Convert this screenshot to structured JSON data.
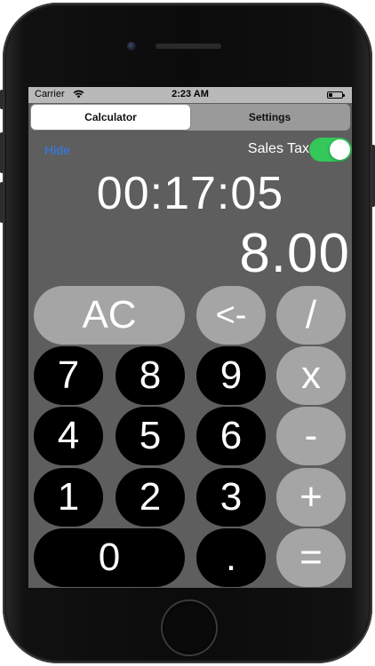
{
  "status_bar": {
    "carrier": "Carrier",
    "time": "2:23 AM"
  },
  "segments": [
    {
      "label": "Calculator",
      "active": true
    },
    {
      "label": "Settings",
      "active": false
    }
  ],
  "controls": {
    "hide_label": "Hide",
    "sales_tax_label": "Sales Tax",
    "sales_tax_on": true
  },
  "timer": "00:17:05",
  "display_value": "8.00",
  "keys": {
    "ac": "AC",
    "backspace": "<-",
    "divide": "/",
    "seven": "7",
    "eight": "8",
    "nine": "9",
    "multiply": "x",
    "four": "4",
    "five": "5",
    "six": "6",
    "minus": "-",
    "one": "1",
    "two": "2",
    "three": "3",
    "plus": "+",
    "zero": "0",
    "decimal": ".",
    "equals": "="
  },
  "colors": {
    "screen_bg": "#5e5e5e",
    "key_gray": "#a5a5a5",
    "key_black": "#000000",
    "toggle_on": "#34c759",
    "link_blue": "#2f7df6"
  }
}
